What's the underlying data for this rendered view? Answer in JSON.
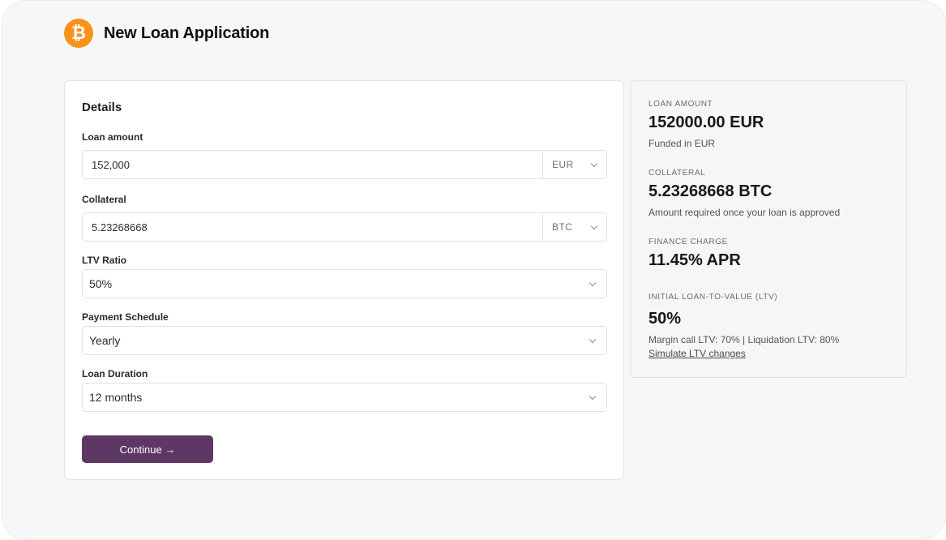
{
  "header": {
    "logo_glyph": "₿",
    "logo_icon": "bitcoin-icon",
    "title": "New Loan Application"
  },
  "form": {
    "section_title": "Details",
    "loan_amount": {
      "label": "Loan amount",
      "value": "152,000",
      "currency": "EUR"
    },
    "collateral": {
      "label": "Collateral",
      "value": "5.23268668",
      "currency": "BTC"
    },
    "ltv_ratio": {
      "label": "LTV Ratio",
      "value": "50%"
    },
    "payment_schedule": {
      "label": "Payment Schedule",
      "value": "Yearly"
    },
    "loan_duration": {
      "label": "Loan Duration",
      "value": "12 months"
    },
    "continue_label": "Continue →"
  },
  "summary": {
    "loan_amount": {
      "label": "LOAN AMOUNT",
      "value": "152000.00 EUR",
      "sub": "Funded in EUR"
    },
    "collateral": {
      "label": "COLLATERAL",
      "value": "5.23268668 BTC",
      "sub": "Amount required once your loan is approved"
    },
    "finance_charge": {
      "label": "FINANCE CHARGE",
      "value": "11.45% APR"
    },
    "initial_ltv": {
      "label": "INITIAL LOAN-TO-VALUE (LTV)",
      "value": "50%",
      "sub": "Margin call LTV: 70% | Liquidation LTV: 80%",
      "link": "Simulate LTV changes"
    }
  },
  "colors": {
    "brand_orange": "#f7931a",
    "button_purple": "#5e3864"
  }
}
